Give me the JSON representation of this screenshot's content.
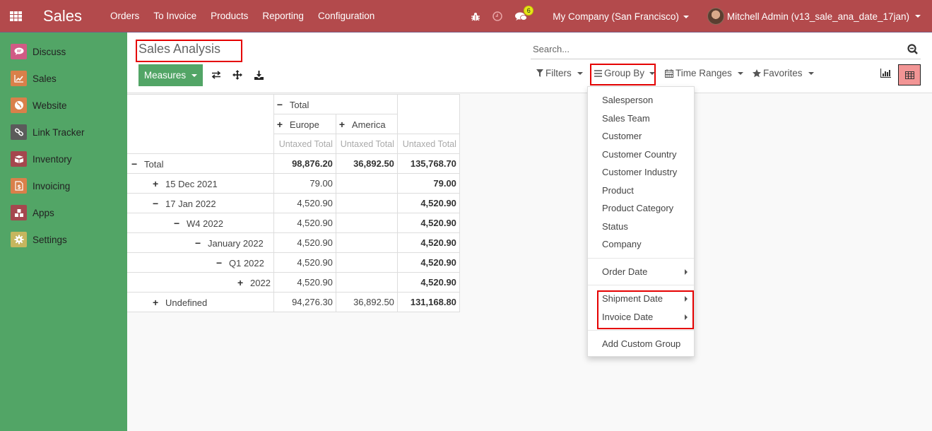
{
  "navbar": {
    "brand": "Sales",
    "menu": [
      "Orders",
      "To Invoice",
      "Products",
      "Reporting",
      "Configuration"
    ],
    "messages_count": "6",
    "company": "My Company (San Francisco)",
    "user": "Mitchell Admin (v13_sale_ana_date_17jan)",
    "color": "#b34a4c"
  },
  "sidebar": {
    "items": [
      {
        "label": "Discuss",
        "icon": "chat-bubble-icon",
        "color": "#d15b85"
      },
      {
        "label": "Sales",
        "icon": "trend-chart-icon",
        "color": "#d9804a"
      },
      {
        "label": "Website",
        "icon": "globe-icon",
        "color": "#d9804a"
      },
      {
        "label": "Link Tracker",
        "icon": "link-icon",
        "color": "#5b5b5b"
      },
      {
        "label": "Inventory",
        "icon": "box-icon",
        "color": "#a5474e"
      },
      {
        "label": "Invoicing",
        "icon": "invoice-icon",
        "color": "#d9804a"
      },
      {
        "label": "Apps",
        "icon": "cubes-icon",
        "color": "#a5474e"
      },
      {
        "label": "Settings",
        "icon": "gear-icon",
        "color": "#c6b65e"
      }
    ],
    "color": "#52a566"
  },
  "control_panel": {
    "title": "Sales Analysis",
    "measures_label": "Measures",
    "search_placeholder": "Search...",
    "filters_label": "Filters",
    "groupby_label": "Group By",
    "timeranges_label": "Time Ranges",
    "favorites_label": "Favorites"
  },
  "pivot": {
    "col_total": "Total",
    "col_groups": [
      "Europe",
      "America"
    ],
    "measure": "Untaxed Total",
    "rows": [
      {
        "label": "Total",
        "sign": "−",
        "indent": 0,
        "values": [
          "98,876.20",
          "36,892.50",
          "135,768.70"
        ],
        "bold_all": true
      },
      {
        "label": "15 Dec 2021",
        "sign": "+",
        "indent": 1,
        "values": [
          "79.00",
          "",
          "79.00"
        ]
      },
      {
        "label": "17 Jan 2022",
        "sign": "−",
        "indent": 1,
        "values": [
          "4,520.90",
          "",
          "4,520.90"
        ]
      },
      {
        "label": "W4 2022",
        "sign": "−",
        "indent": 2,
        "values": [
          "4,520.90",
          "",
          "4,520.90"
        ]
      },
      {
        "label": "January 2022",
        "sign": "−",
        "indent": 3,
        "values": [
          "4,520.90",
          "",
          "4,520.90"
        ]
      },
      {
        "label": "Q1 2022",
        "sign": "−",
        "indent": 4,
        "values": [
          "4,520.90",
          "",
          "4,520.90"
        ]
      },
      {
        "label": "2022",
        "sign": "+",
        "indent": 5,
        "values": [
          "4,520.90",
          "",
          "4,520.90"
        ]
      },
      {
        "label": "Undefined",
        "sign": "+",
        "indent": 1,
        "values": [
          "94,276.30",
          "36,892.50",
          "131,168.80"
        ]
      }
    ]
  },
  "groupby_menu": {
    "fields": [
      "Salesperson",
      "Sales Team",
      "Customer",
      "Customer Country",
      "Customer Industry",
      "Product",
      "Product Category",
      "Status",
      "Company"
    ],
    "order_date": "Order Date",
    "shipment_date": "Shipment Date",
    "invoice_date": "Invoice Date",
    "add_custom": "Add Custom Group"
  }
}
